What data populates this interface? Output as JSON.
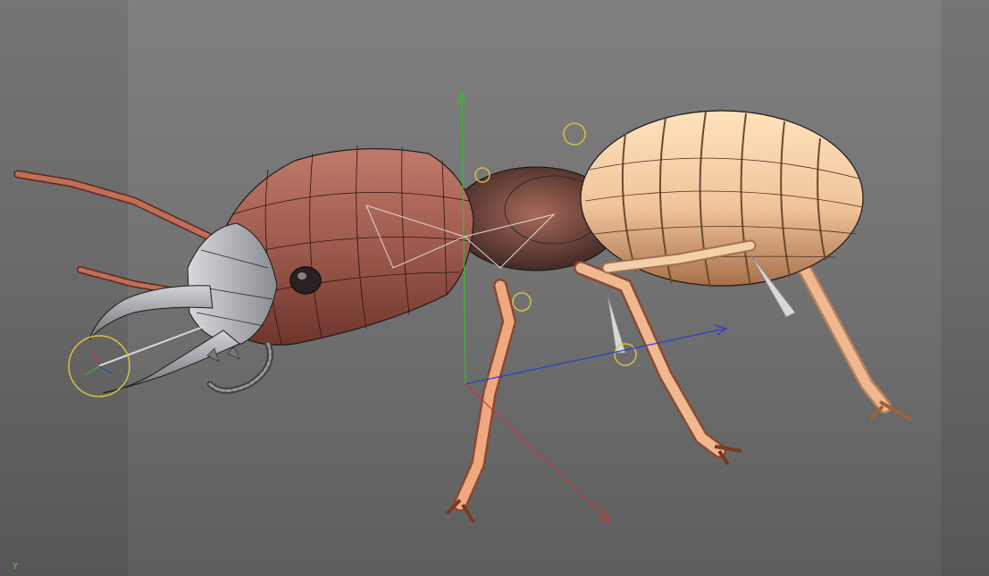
{
  "viewport": {
    "axis_label": "Y",
    "colors": {
      "background_top": "#7f7f7f",
      "background_bottom": "#5e5e5e",
      "head": "#9e5a4e",
      "head_dark": "#6e352c",
      "abdomen": "#f0c49a",
      "abdomen_dark": "#a8704a",
      "legs": "#e8a882",
      "mandibles": "#a8aab0",
      "hair": "#1a1a1a",
      "wireframe": "#111111",
      "axis_x": "#d43030",
      "axis_y": "#30c030",
      "axis_z": "#2a3fd0",
      "controller": "#d8c040"
    },
    "model": {
      "subject": "termite-soldier-rig",
      "display": "wireframe-on-shaded"
    }
  }
}
